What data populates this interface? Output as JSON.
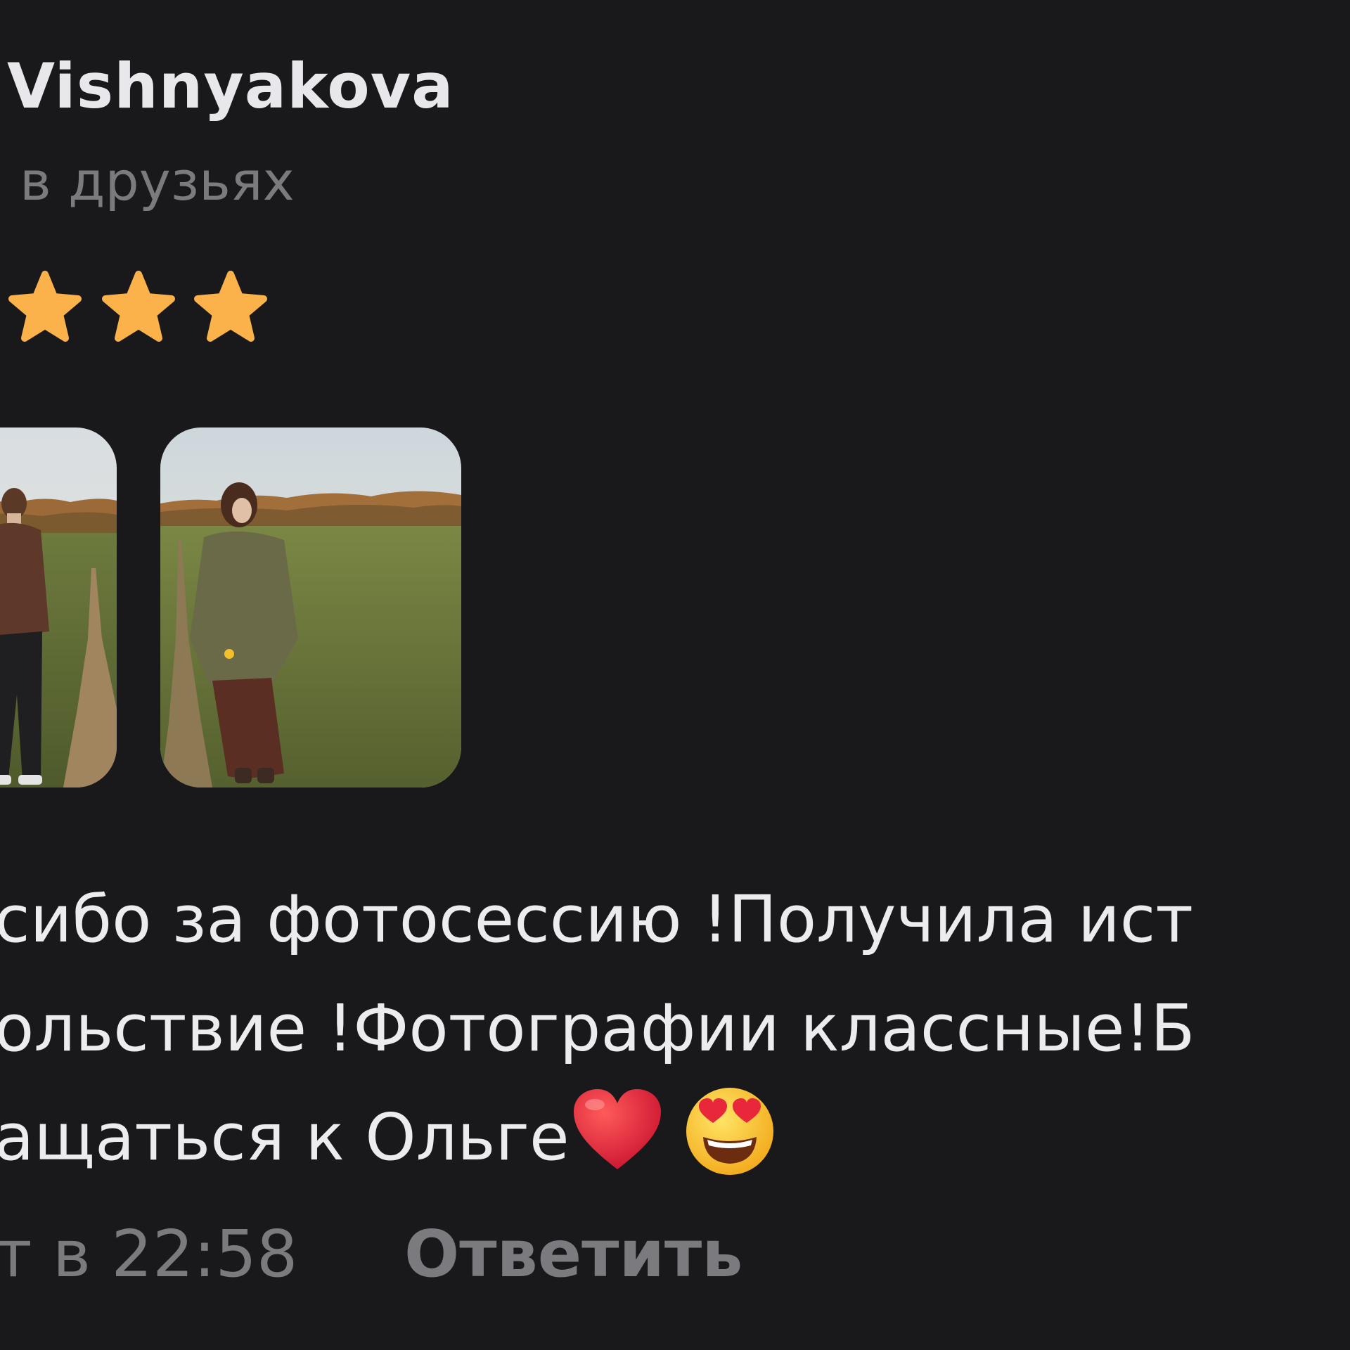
{
  "review": {
    "author_name": "Vishnyakova",
    "friend_status": "в друзьях",
    "rating": {
      "visible_stars": 3,
      "star_color": "#fcb24a"
    },
    "photos": [
      {
        "label": "photo-thumbnail-1"
      },
      {
        "label": "photo-thumbnail-2"
      }
    ],
    "text_lines": [
      "сибо за фотосессию !Получила ист",
      "ольствие !Фотографии классные!Б",
      "ащаться к Ольге"
    ],
    "emojis": [
      "red-heart-icon",
      "heart-eyes-face-icon"
    ],
    "timestamp": "т в 22:58",
    "reply_label": "Ответить"
  },
  "colors": {
    "background": "#19191b",
    "primary_text": "#e8e8ec",
    "secondary_text": "#7a7a7f"
  }
}
